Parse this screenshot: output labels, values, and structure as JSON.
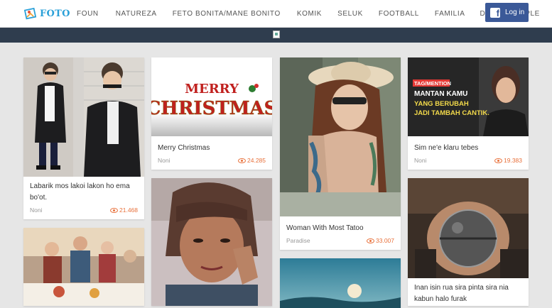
{
  "header": {
    "logo_text": "FOTO",
    "nav": [
      "FOUN",
      "NATUREZA",
      "FETO BONITA/MANE BONITO",
      "KOMIK",
      "SELUK",
      "FOOTBALL",
      "FAMILIA",
      "DOMIN/COUPLE"
    ],
    "login_label": "Log in",
    "login_icon": "facebook-icon"
  },
  "cards": [
    {
      "title": "Labarik mos lakoi lakon ho ema bo'ot.",
      "author": "Noni",
      "views": "21.468",
      "image": "boy-in-suit-photo"
    },
    {
      "title": "Merry Christmas",
      "author": "Noni",
      "views": "24.285",
      "image": "merry-christmas-text",
      "image_text": [
        "MERRY",
        "CHRISTMAS"
      ]
    },
    {
      "title": "Woman With Most Tatoo",
      "author": "Paradise",
      "views": "33.007",
      "image": "tattooed-woman-photo"
    },
    {
      "title": "Sim ne'e klaru tebes",
      "author": "Noni",
      "views": "19.383",
      "image": "meme-poster",
      "image_text": [
        "TAG/MENTION",
        "MANTAN KAMU",
        "YANG BERUBAH",
        "JADI TAMBAH CANTIK."
      ]
    },
    {
      "title": "",
      "author": "",
      "views": "",
      "image": "family-dinner-photo"
    },
    {
      "title": "",
      "author": "",
      "views": "",
      "image": "selfie-woman-photo"
    },
    {
      "title": "",
      "author": "",
      "views": "",
      "image": "sky-photo"
    },
    {
      "title": "Inan isin rua sira pinta sira nia kabun halo furak",
      "author": "",
      "views": "",
      "image": "painted-belly-photo"
    }
  ]
}
